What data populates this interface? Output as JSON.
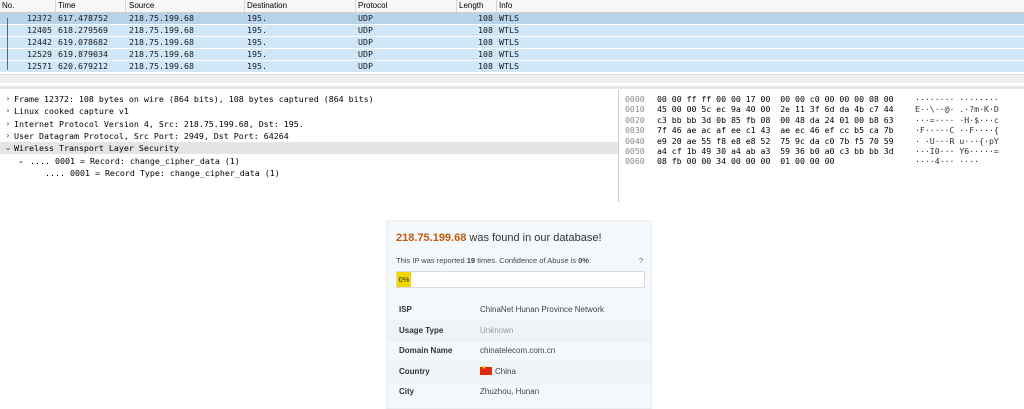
{
  "packet_list": {
    "columns": [
      "No.",
      "Time",
      "Source",
      "Destination",
      "Protocol",
      "Length",
      "Info"
    ],
    "rows": [
      {
        "no": "12372",
        "time": "617.478752",
        "src": "218.75.199.68",
        "dst": "195.",
        "proto": "UDP",
        "len": "108",
        "info": "WTLS"
      },
      {
        "no": "12405",
        "time": "618.279569",
        "src": "218.75.199.68",
        "dst": "195.",
        "proto": "UDP",
        "len": "108",
        "info": "WTLS"
      },
      {
        "no": "12442",
        "time": "619.078682",
        "src": "218.75.199.68",
        "dst": "195.",
        "proto": "UDP",
        "len": "108",
        "info": "WTLS"
      },
      {
        "no": "12529",
        "time": "619.879034",
        "src": "218.75.199.68",
        "dst": "195.",
        "proto": "UDP",
        "len": "108",
        "info": "WTLS"
      },
      {
        "no": "12571",
        "time": "620.679212",
        "src": "218.75.199.68",
        "dst": "195.",
        "proto": "UDP",
        "len": "108",
        "info": "WTLS"
      }
    ]
  },
  "details": [
    {
      "arrow": "›",
      "text": "Frame 12372: 108 bytes on wire (864 bits), 108 bytes captured (864 bits)"
    },
    {
      "arrow": "›",
      "text": "Linux cooked capture v1"
    },
    {
      "arrow": "›",
      "text": "Internet Protocol Version 4, Src: 218.75.199.68, Dst: 195."
    },
    {
      "arrow": "›",
      "text": "User Datagram Protocol, Src Port: 2949, Dst Port: 64264"
    },
    {
      "arrow": "⌄",
      "text": "Wireless Transport Layer Security"
    },
    {
      "arrow": "⌄",
      "text": ".... 0001 = Record: change_cipher_data (1)"
    },
    {
      "arrow": "",
      "text": ".... 0001 = Record Type: change_cipher_data (1)"
    }
  ],
  "bytes": [
    {
      "off": "0000",
      "hex": "00 00 ff ff 00 00 17 00  00 00 c0 00 00 00 08 00",
      "ascii": "········ ········"
    },
    {
      "off": "0010",
      "hex": "45 00 00 5c ec 9a 40 00  2e 11 3f 6d da 4b c7 44",
      "ascii": "E··\\··@· .·?m·K·D"
    },
    {
      "off": "0020",
      "hex": "c3 bb bb 3d 0b 85 fb 08  00 48 da 24 01 00 b8 63",
      "ascii": "···=···· ·H·$···c"
    },
    {
      "off": "0030",
      "hex": "7f 46 ae ac af ee c1 43  ae ec 46 ef cc b5 ca 7b",
      "ascii": "·F·····C ··F····{"
    },
    {
      "off": "0040",
      "hex": "e9 20 ae 55 f8 e8 e8 52  75 9c da c0 7b f5 70 59",
      "ascii": "· ·U···R u···{·pY"
    },
    {
      "off": "0050",
      "hex": "a4 cf 1b 49 30 a4 ab a3  59 36 b0 a0 c3 bb bb 3d",
      "ascii": "···I0··· Y6·····="
    },
    {
      "off": "0060",
      "hex": "08 fb 00 00 34 00 00 00  01 00 00 00",
      "ascii": "····4··· ····"
    }
  ],
  "abuse": {
    "ip": "218.75.199.68",
    "title_suffix": "was found in our database!",
    "reported_prefix": "This IP was reported",
    "reported_count": "19",
    "reported_mid": "times. Confidence of Abuse is",
    "confidence": "0%",
    "reported_end": ":",
    "help": "?",
    "bar_label": "0%",
    "confidence_fraction": 0.0,
    "rows": [
      {
        "key": "ISP",
        "value": "ChinaNet Hunan Province Network",
        "muted": false,
        "flag": false
      },
      {
        "key": "Usage Type",
        "value": "Unknown",
        "muted": true,
        "flag": false
      },
      {
        "key": "Domain Name",
        "value": "chinatelecom.com.cn",
        "muted": false,
        "flag": false
      },
      {
        "key": "Country",
        "value": "China",
        "muted": false,
        "flag": true
      },
      {
        "key": "City",
        "value": "Zhuzhou, Hunan",
        "muted": false,
        "flag": false
      }
    ]
  }
}
